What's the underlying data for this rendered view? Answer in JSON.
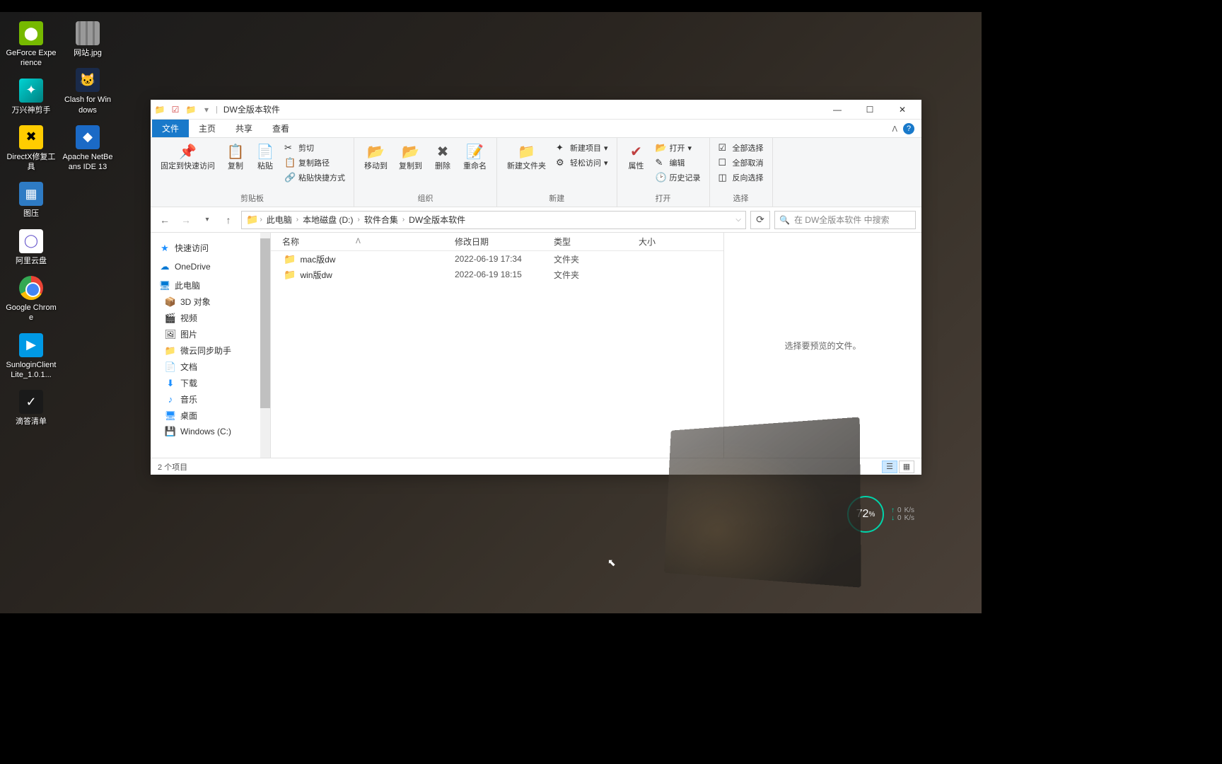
{
  "desktop": {
    "icons_col1": [
      {
        "label": "GeForce Experience",
        "cls": "nvidia",
        "glyph": "⬤"
      },
      {
        "label": "万兴神剪手",
        "cls": "wanxing",
        "glyph": "✦"
      },
      {
        "label": "DirectX修复工具",
        "cls": "directx",
        "glyph": "✖"
      },
      {
        "label": "图压",
        "cls": "tuya",
        "glyph": "▦"
      },
      {
        "label": "阿里云盘",
        "cls": "ali",
        "glyph": "◯"
      },
      {
        "label": "Google Chrome",
        "cls": "chrome",
        "glyph": ""
      },
      {
        "label": "SunloginClientLite_1.0.1...",
        "cls": "sunlogin",
        "glyph": "▶"
      },
      {
        "label": "滴答清单",
        "cls": "dida",
        "glyph": "✓"
      }
    ],
    "icons_col2": [
      {
        "label": "网站.jpg",
        "cls": "img-file",
        "glyph": ""
      },
      {
        "label": "Clash for Windows",
        "cls": "clash",
        "glyph": "🐱"
      },
      {
        "label": "Apache NetBeans IDE 13",
        "cls": "netbeans",
        "glyph": "◆"
      }
    ]
  },
  "widget": {
    "percent": "72",
    "unit": "%",
    "up": "0",
    "up_unit": "K/s",
    "down": "0",
    "down_unit": "K/s"
  },
  "explorer": {
    "title": "DW全版本软件",
    "tabs": {
      "file": "文件",
      "home": "主页",
      "share": "共享",
      "view": "查看"
    },
    "ribbon": {
      "pin": "固定到快速访问",
      "copy": "复制",
      "paste": "粘贴",
      "cut": "剪切",
      "copy_path": "复制路径",
      "paste_shortcut": "粘贴快捷方式",
      "clipboard": "剪贴板",
      "move_to": "移动到",
      "copy_to": "复制到",
      "delete": "删除",
      "rename": "重命名",
      "organize": "组织",
      "new_folder": "新建文件夹",
      "new_item": "新建项目",
      "easy_access": "轻松访问",
      "new": "新建",
      "properties": "属性",
      "open": "打开",
      "edit": "编辑",
      "history": "历史记录",
      "open_group": "打开",
      "select_all": "全部选择",
      "select_none": "全部取消",
      "invert_selection": "反向选择",
      "select": "选择"
    },
    "breadcrumb": [
      "此电脑",
      "本地磁盘 (D:)",
      "软件合集",
      "DW全版本软件"
    ],
    "search_placeholder": "在 DW全版本软件 中搜索",
    "nav": {
      "quick_access": "快速访问",
      "onedrive": "OneDrive",
      "this_pc": "此电脑",
      "objects_3d": "3D 对象",
      "videos": "视频",
      "pictures": "图片",
      "weiyun": "微云同步助手",
      "documents": "文档",
      "downloads": "下载",
      "music": "音乐",
      "desktop": "桌面",
      "windows_c": "Windows (C:)"
    },
    "columns": {
      "name": "名称",
      "date": "修改日期",
      "type": "类型",
      "size": "大小"
    },
    "files": [
      {
        "name": "mac版dw",
        "date": "2022-06-19 17:34",
        "type": "文件夹"
      },
      {
        "name": "win版dw",
        "date": "2022-06-19 18:15",
        "type": "文件夹"
      }
    ],
    "preview_hint": "选择要预览的文件。",
    "status": "2 个项目"
  }
}
